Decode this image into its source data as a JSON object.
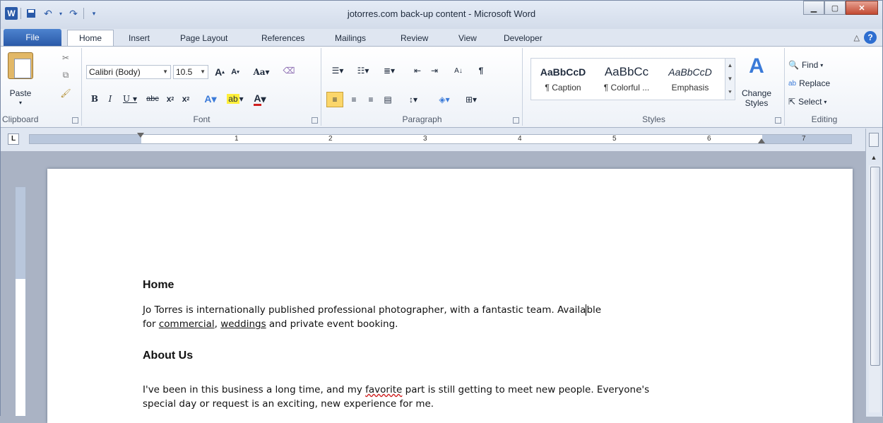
{
  "window": {
    "title": "jotorres.com back-up content - Microsoft Word"
  },
  "tabs": [
    "File",
    "Home",
    "Insert",
    "Page Layout",
    "References",
    "Mailings",
    "Review",
    "View",
    "Developer"
  ],
  "ribbon": {
    "clipboard": {
      "label": "Clipboard",
      "paste": "Paste"
    },
    "font": {
      "label": "Font",
      "name": "Calibri (Body)",
      "size": "10.5"
    },
    "paragraph": {
      "label": "Paragraph"
    },
    "styles": {
      "label": "Styles",
      "items": [
        {
          "preview": "AaBbCcD",
          "name": "¶ Caption"
        },
        {
          "preview": "AaBbCc",
          "name": "¶ Colorful ..."
        },
        {
          "preview": "AaBbCcD",
          "name": "Emphasis"
        }
      ],
      "change_styles": "Change Styles"
    },
    "editing": {
      "label": "Editing",
      "find": "Find",
      "replace": "Replace",
      "select": "Select"
    }
  },
  "ruler": {
    "numbers": [
      "1",
      "2",
      "3",
      "4",
      "5",
      "6",
      "7"
    ]
  },
  "document": {
    "heading1": "Home",
    "para1_start": "Jo Torres is internationally  published professional photographer,  with a fantastic  team. Availa",
    "para1_end": "ble",
    "para1_line2_pre": "for ",
    "link_commercial": "commercial",
    "para1_mid": ",  ",
    "link_weddings": "weddings",
    "para1_line2_post": " and private  event booking.",
    "heading2": "About Us",
    "para2_pre": "I've been in this business a long time, and my ",
    "para2_misspelled": "favorite",
    "para2_post": "  part is still getting to meet new people. Everyone's",
    "para2_line2": "special day or request is an exciting,  new experience for me."
  }
}
